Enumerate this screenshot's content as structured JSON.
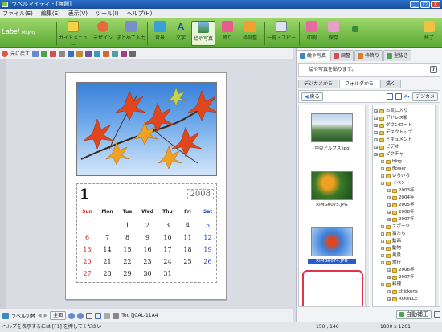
{
  "window": {
    "title": "ラベルマイティ - [無題]"
  },
  "menu": [
    "ファイル(E)",
    "編集(E)",
    "表示(V)",
    "ツール(I)",
    "ヘルプ(H)"
  ],
  "logo": {
    "main": "Label",
    "sub": "Mighty"
  },
  "toolbar": {
    "guide": "ガイドメニュー",
    "design": "デザイン",
    "batch": "まとめて入力",
    "background": "背景",
    "text": "文字",
    "picture": "絵や写真",
    "decoration": "飾り",
    "frame": "枠調整",
    "copy": "一覧・コピー",
    "print": "印刷",
    "save": "保存",
    "exit": "終了"
  },
  "undo_label": "元に戻す",
  "calendar": {
    "month": "1",
    "year": "2008",
    "days": [
      "Sun",
      "Mon",
      "Tue",
      "Wed",
      "Thu",
      "Fri",
      "Sat"
    ],
    "weeks": [
      [
        "",
        "",
        "1",
        "2",
        "3",
        "4",
        "5"
      ],
      [
        "6",
        "7",
        "8",
        "9",
        "10",
        "11",
        "12"
      ],
      [
        "13",
        "14",
        "15",
        "16",
        "17",
        "18",
        "19"
      ],
      [
        "20",
        "21",
        "22",
        "23",
        "24",
        "25",
        "26"
      ],
      [
        "27",
        "28",
        "29",
        "30",
        "31",
        "",
        ""
      ]
    ]
  },
  "bottom_bar": {
    "label_switch": "ラベル切替",
    "fit": "全面",
    "template": "Too [JCAL-11A4"
  },
  "status": {
    "help": "ヘルプを表示するには [F1] を押してください",
    "coords": "150 , 146",
    "size": "1800 x 1261"
  },
  "panel": {
    "tabs": [
      "絵や写真",
      "調整",
      "枠飾り",
      "型抜き"
    ],
    "info": "絵や写真を貼ります。",
    "subtabs": [
      "デジカメから",
      "フォルダから",
      "描く"
    ],
    "back": "戻る",
    "digicam_btn": "デジカメ",
    "auto_btn": "自動補正",
    "thumbs": [
      {
        "name": "中央アルプス.jpg"
      },
      {
        "name": "RIMG0075.JPG"
      },
      {
        "name": "RIMG0074.JPG"
      }
    ],
    "tree": [
      "お気に入り",
      "アドレス帳",
      "ダウンロード",
      "デスクトップ",
      "ドキュメント",
      "ビデオ",
      "ピクチャ",
      "blog",
      "flower",
      "いろいろ",
      "イベント",
      "2003年",
      "2004年",
      "2005年",
      "2006年",
      "2007年",
      "スポーツ",
      "猫たち",
      "動画",
      "動物",
      "風景",
      "旅行",
      "2006年",
      "2007年",
      "料理",
      "chickens",
      "ROUILLE"
    ]
  },
  "colors": {
    "toolbar_green": "#5aa834",
    "highlight_red": "#e0344a",
    "sunday_red": "#d01818",
    "saturday_blue": "#1a3fd0"
  }
}
